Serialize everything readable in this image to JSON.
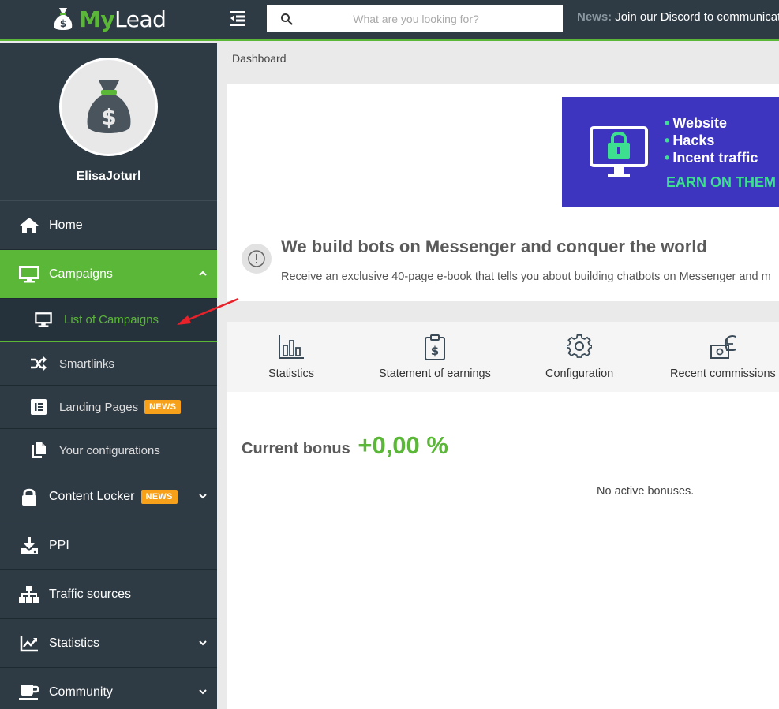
{
  "header": {
    "logo_my": "My",
    "logo_lead": "Lead",
    "search_placeholder": "What are you looking for?",
    "news_label": "News:",
    "news_text": "Join our Discord to communicat"
  },
  "sidebar": {
    "username": "ElisaJoturl",
    "items": [
      {
        "label": "Home",
        "icon": "home-icon"
      },
      {
        "label": "Campaigns",
        "icon": "monitor-icon",
        "active": true
      },
      {
        "label": "Content Locker",
        "icon": "lock-icon",
        "badge": "NEWS"
      },
      {
        "label": "PPI",
        "icon": "download-icon"
      },
      {
        "label": "Traffic sources",
        "icon": "sitemap-icon"
      },
      {
        "label": "Statistics",
        "icon": "chart-line-icon"
      },
      {
        "label": "Community",
        "icon": "coffee-icon"
      }
    ],
    "subitems": [
      {
        "label": "List of Campaigns",
        "icon": "monitor-icon",
        "current": true
      },
      {
        "label": "Smartlinks",
        "icon": "shuffle-icon"
      },
      {
        "label": "Landing Pages",
        "icon": "elementor-icon",
        "badge": "NEWS"
      },
      {
        "label": "Your configurations",
        "icon": "files-icon"
      }
    ]
  },
  "main": {
    "breadcrumb": "Dashboard",
    "ad": {
      "bullets": [
        "Website",
        "Hacks",
        "Incent traffic"
      ],
      "cta": "EARN ON THEM I"
    },
    "promo": {
      "title": "We build bots on Messenger and conquer the world",
      "text": "Receive an exclusive 40-page e-book that tells you about building chatbots on Messenger and m"
    },
    "tools": [
      {
        "label": "Statistics",
        "icon": "bar-chart-icon"
      },
      {
        "label": "Statement of earnings",
        "icon": "clipboard-dollar-icon"
      },
      {
        "label": "Configuration",
        "icon": "gear-icon"
      },
      {
        "label": "Recent commissions",
        "icon": "money-chart-icon"
      }
    ],
    "bonus": {
      "label": "Current bonus",
      "value": "+0,00 %",
      "empty_text": "No active bonuses."
    }
  },
  "colors": {
    "accent": "#5ab737",
    "sidebar_bg": "#2e3a44",
    "badge": "#f7a11a",
    "ad_bg": "#3d35c0",
    "ad_green": "#3de08e"
  }
}
